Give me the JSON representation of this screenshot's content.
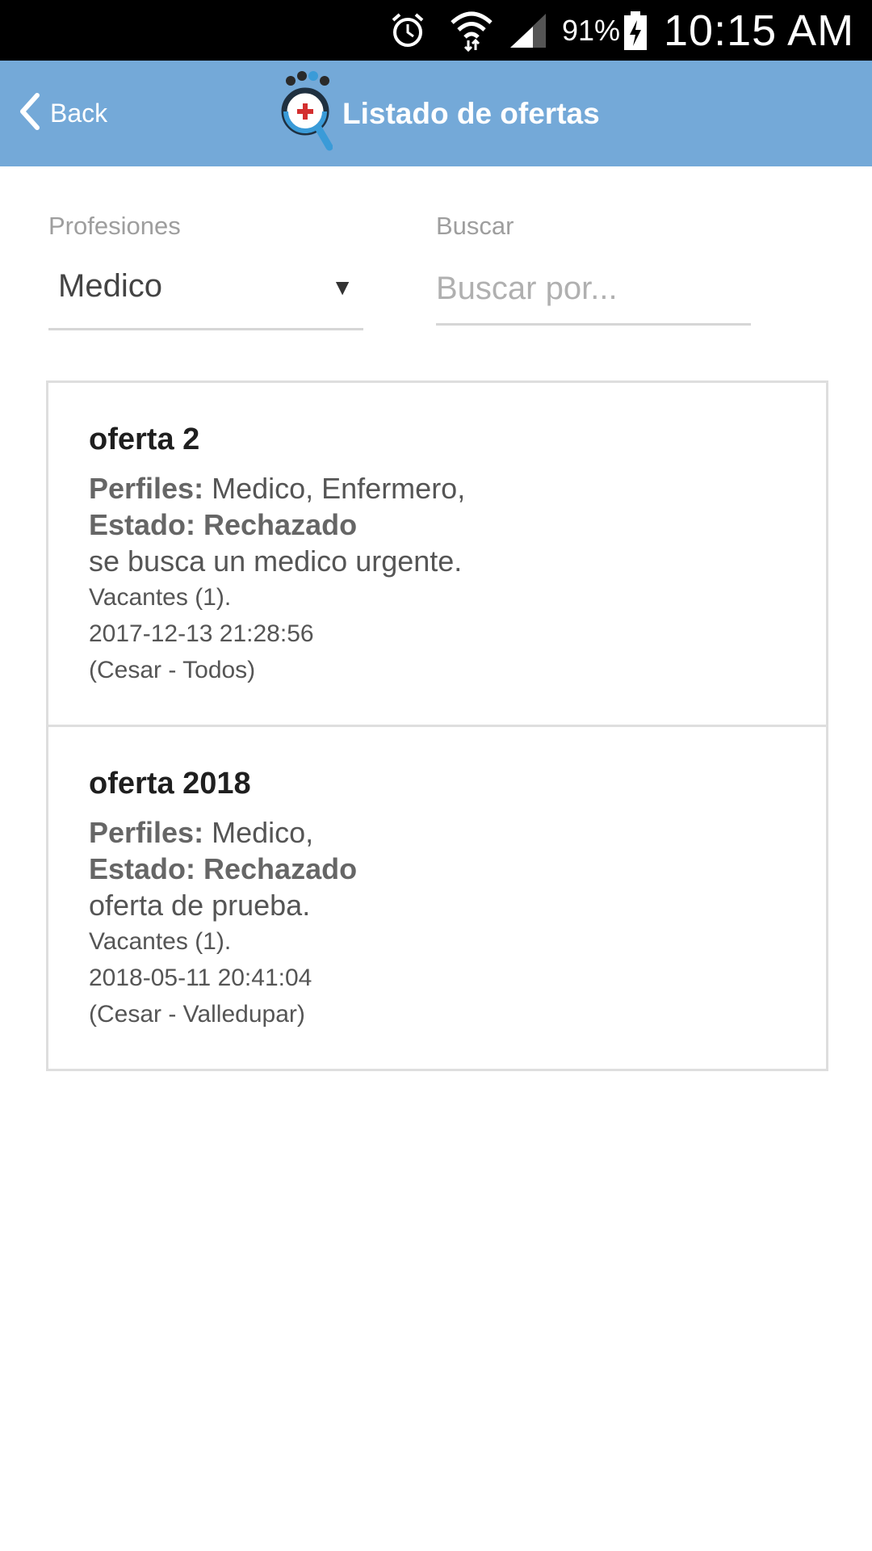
{
  "status_bar": {
    "battery_percent": "91%",
    "time": "10:15 AM",
    "icons": [
      "alarm-icon",
      "wifi-icon",
      "signal-icon",
      "battery-charging-icon"
    ]
  },
  "header": {
    "back_label": "Back",
    "title": "Listado de ofertas",
    "background_color": "#74a9d8"
  },
  "filters": {
    "profesiones_label": "Profesiones",
    "profesiones_value": "Medico",
    "buscar_label": "Buscar",
    "buscar_placeholder": "Buscar por..."
  },
  "offers": [
    {
      "title": "oferta 2",
      "perfiles_label": "Perfiles:",
      "perfiles_value": " Medico, Enfermero,",
      "estado": "Estado: Rechazado",
      "description": "se busca un medico urgente.",
      "vacantes": "Vacantes (1).",
      "date": "2017-12-13 21:28:56",
      "location": "(Cesar - Todos)"
    },
    {
      "title": "oferta 2018",
      "perfiles_label": "Perfiles:",
      "perfiles_value": " Medico,",
      "estado": "Estado: Rechazado",
      "description": "oferta de prueba.",
      "vacantes": "Vacantes (1).",
      "date": "2018-05-11 20:41:04",
      "location": "(Cesar - Valledupar)"
    }
  ]
}
